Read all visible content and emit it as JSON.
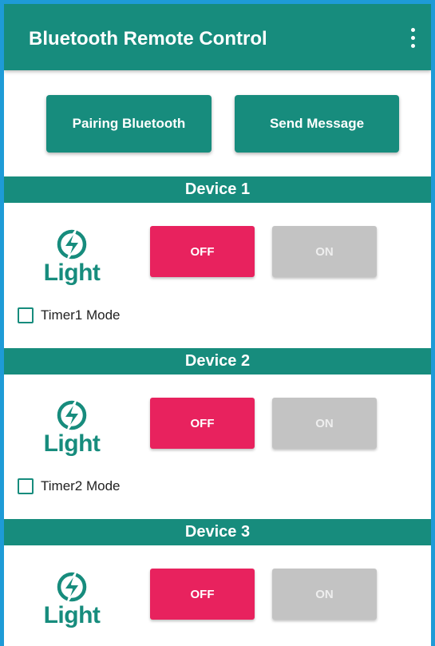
{
  "app": {
    "title": "Bluetooth Remote Control",
    "menu_icon": "more-vert-icon"
  },
  "actions": {
    "pairing_label": "Pairing Bluetooth",
    "send_label": "Send Message"
  },
  "devices": [
    {
      "title": "Device 1",
      "logo_text": "Light",
      "off_label": "OFF",
      "on_label": "ON",
      "timer_label": "Timer1 Mode",
      "timer_checked": false
    },
    {
      "title": "Device 2",
      "logo_text": "Light",
      "off_label": "OFF",
      "on_label": "ON",
      "timer_label": "Timer2 Mode",
      "timer_checked": false
    },
    {
      "title": "Device 3",
      "logo_text": "Light",
      "off_label": "OFF",
      "on_label": "ON"
    }
  ],
  "colors": {
    "primary": "#178c7d",
    "off_active": "#e8225e",
    "on_inactive": "#c3c3c3",
    "frame_border": "#1e9bd7"
  }
}
